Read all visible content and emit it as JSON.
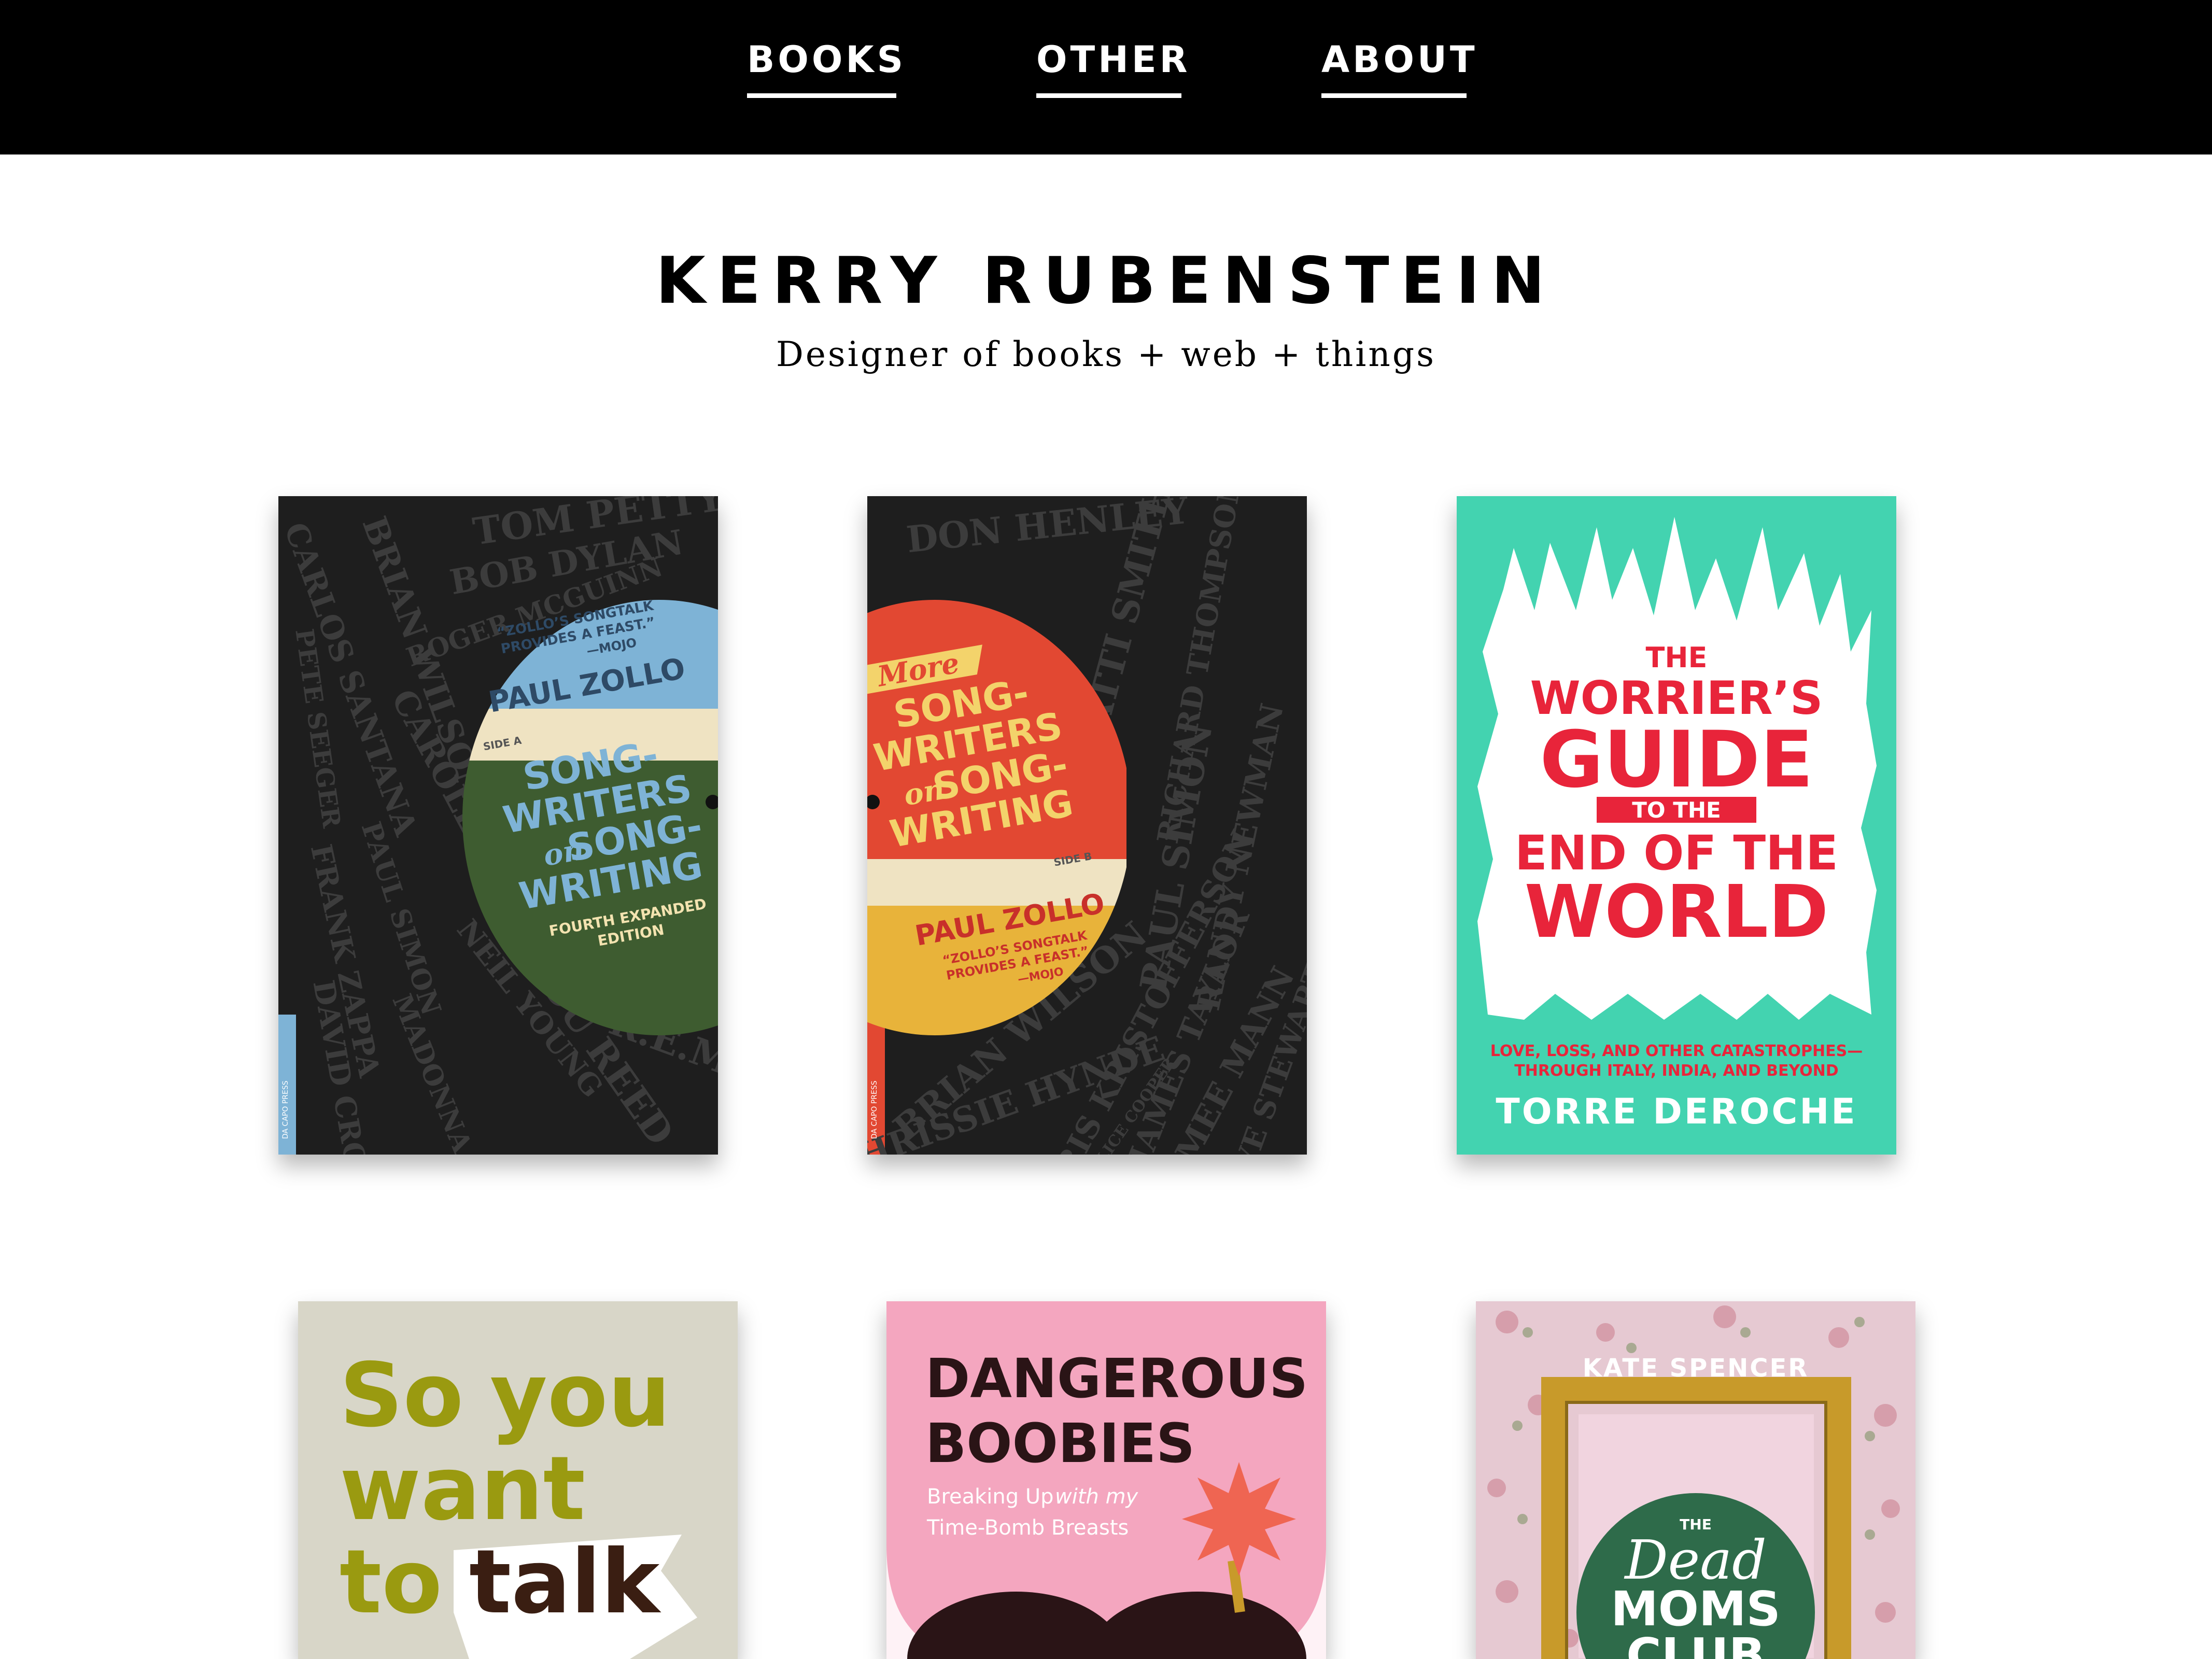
{
  "nav": {
    "items": [
      {
        "label": "BOOKS"
      },
      {
        "label": "OTHER"
      },
      {
        "label": "ABOUT"
      }
    ]
  },
  "header": {
    "title": "KERRY RUBENSTEIN",
    "tagline": "Designer of books + web + things"
  },
  "books": [
    {
      "quote_line1": "“ZOLLO’S SONGTALK",
      "quote_line2": "PROVIDES A FEAST.”",
      "quote_attr": "—MOJO",
      "author": "PAUL ZOLLO",
      "side": "SIDE A",
      "title_1": "SONG-",
      "title_2": "WRITERS",
      "title_3_on": "on",
      "title_3": "SONG-",
      "title_4": "WRITING",
      "edition_1": "FOURTH EXPANDED",
      "edition_2": "EDITION",
      "names": [
        "TOM PETTY",
        "BOB DYLAN",
        "CARLOS SANTANA",
        "BRIAN WILSON",
        "CAROLE KING",
        "LOU REED",
        "R.E.M.",
        "FRANK ZAPPA",
        "PAUL SIMON",
        "NEIL YOUNG",
        "MADONNA",
        "DAVID CROSBY",
        "ROGER MCGUINN",
        "PETE SEEGER"
      ],
      "spine": "DA CAPO PRESS",
      "colors": {
        "bg": "#1e1e1e",
        "blue": "#7eb3d6",
        "cream": "#efe3c2",
        "green": "#3e5c30",
        "text": "#2e5a7a",
        "yellow": "#f3d36b"
      }
    },
    {
      "title_more": "More",
      "title_1": "SONG-",
      "title_2": "WRITERS",
      "title_3_on": "on",
      "title_3": "SONG-",
      "title_4": "WRITING",
      "side": "SIDE B",
      "author": "PAUL ZOLLO",
      "quote_line1": "“ZOLLO’S SONGTALK",
      "quote_line2": "PROVIDES A FEAST.”",
      "quote_attr": "—MOJO",
      "names": [
        "DON HENLEY",
        "PATTI SMITH",
        "PAUL SIMON",
        "BRIAN WILSON",
        "CHRISSIE HYNDE",
        "KRIS KRISTOFFERSON",
        "RICHARD THOMPSON",
        "JAMES TAYLOR",
        "RANDY NEWMAN",
        "AIMEE MANN",
        "DAVE STEWART",
        "ALICE COOPER"
      ],
      "spine": "DA CAPO PRESS",
      "colors": {
        "bg": "#1e1e1e",
        "red": "#e24832",
        "cream": "#efe3c2",
        "yellow": "#e8b33a",
        "text": "#f3d36b"
      }
    },
    {
      "title_the": "THE",
      "title_1": "WORRIER’S",
      "title_2": "GUIDE",
      "title_to_the": "TO THE",
      "title_3": "END OF THE",
      "title_4": "WORLD",
      "subtitle_1": "LOVE, LOSS, AND OTHER CATASTROPHES—",
      "subtitle_2": "THROUGH ITALY, INDIA, AND BEYOND",
      "author": "TORRE DEROCHE",
      "colors": {
        "bg": "#43d3b0",
        "red": "#e8243a",
        "white": "#ffffff"
      }
    },
    {
      "line_1a": "So",
      "line_1b": "you",
      "line_2": "want",
      "line_3a": "to",
      "line_3b": "talk",
      "colors": {
        "bg": "#d8d6c8",
        "olive": "#9a9a10",
        "dark": "#3a1e12"
      }
    },
    {
      "title_1": "DANGEROUS",
      "title_2": "BOOBIES",
      "sub_1a": "Breaking Up",
      "sub_1b": "with my",
      "sub_2": "Time-Bomb Breasts",
      "colors": {
        "bg": "#f4a6bf",
        "dark": "#2a1416",
        "burst": "#ef6552"
      }
    },
    {
      "author": "KATE SPENCER",
      "the": "THE",
      "dead": "Dead",
      "moms": "MOMS",
      "club": "CLUB",
      "colors": {
        "bg": "#e6c9d2",
        "gold": "#c89a2a",
        "green": "#2e6b4a"
      }
    }
  ]
}
